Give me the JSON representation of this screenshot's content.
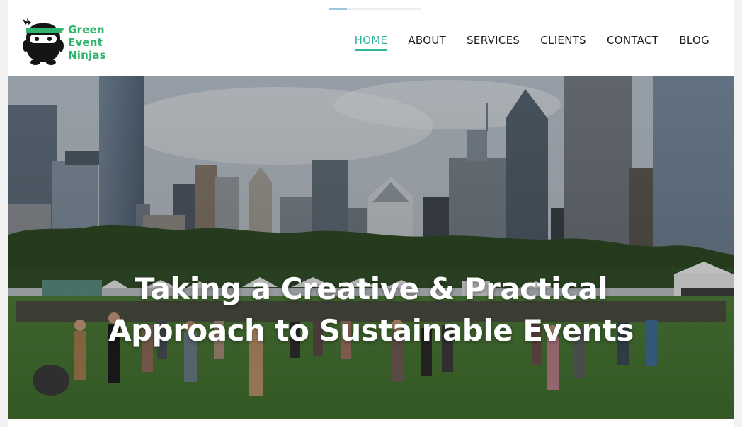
{
  "brand": {
    "name_line1": "Green",
    "name_line2": "Event",
    "name_line3": "Ninjas",
    "color": "#2fb56d",
    "icon": "ninja-mascot-icon"
  },
  "nav": {
    "items": [
      {
        "label": "HOME",
        "active": true
      },
      {
        "label": "ABOUT",
        "active": false
      },
      {
        "label": "SERVICES",
        "active": false
      },
      {
        "label": "CLIENTS",
        "active": false
      },
      {
        "label": "CONTACT",
        "active": false
      },
      {
        "label": "BLOG",
        "active": false
      }
    ],
    "active_color": "#2fb59a"
  },
  "hero": {
    "heading_line1": "Taking a Creative & Practical",
    "heading_line2": "Approach to Sustainable Events",
    "image": "festival-crowd-city-skyline-photo"
  }
}
